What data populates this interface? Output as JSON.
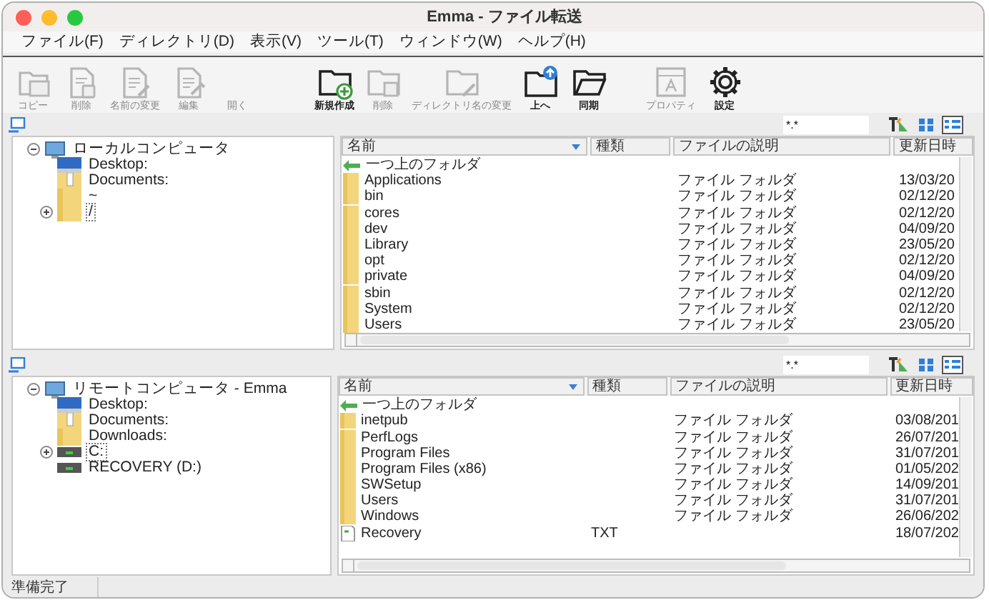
{
  "window": {
    "title": "Emma - ファイル転送"
  },
  "menu": [
    "ファイル(F)",
    "ディレクトリ(D)",
    "表示(V)",
    "ツール(T)",
    "ウィンドウ(W)",
    "ヘルプ(H)"
  ],
  "toolbar": [
    {
      "kind": "copy",
      "label": "コピー",
      "disabled": true
    },
    {
      "kind": "delete",
      "label": "削除",
      "disabled": true
    },
    {
      "kind": "rename",
      "label": "名前の変更",
      "disabled": true
    },
    {
      "kind": "edit",
      "label": "編集",
      "disabled": true
    },
    {
      "kind": "open",
      "label": "開く",
      "disabled": true
    },
    {
      "kind": "new-folder",
      "label": "新規作成",
      "disabled": false
    },
    {
      "kind": "delete-folder",
      "label": "削除",
      "disabled": true
    },
    {
      "kind": "rename-folder",
      "label": "ディレクトリ名の変更",
      "disabled": true
    },
    {
      "kind": "up",
      "label": "上へ",
      "disabled": false
    },
    {
      "kind": "sync",
      "label": "同期",
      "disabled": false
    },
    {
      "kind": "properties",
      "label": "プロパティ",
      "disabled": true
    },
    {
      "kind": "settings",
      "label": "設定",
      "disabled": false
    }
  ],
  "panes": [
    {
      "filter": "*.*",
      "view_buttons": [
        {
          "kind": "icons",
          "selected": false
        },
        {
          "kind": "details",
          "selected": true
        }
      ],
      "tree": [
        {
          "kind": "computer",
          "label": "ローカルコンピュータ",
          "expanded": true,
          "selected": false,
          "children": [
            {
              "kind": "desktop",
              "label": "Desktop:",
              "selected": false
            },
            {
              "kind": "documents",
              "label": "Documents:",
              "selected": false
            },
            {
              "kind": "folder",
              "label": "~",
              "selected": false
            },
            {
              "kind": "folder",
              "label": "/",
              "expanded": false,
              "selected": true
            }
          ]
        }
      ],
      "columns": [
        "名前",
        "種類",
        "ファイルの説明",
        "更新日時"
      ],
      "rows": [
        {
          "kind": "up",
          "name": "一つ上のフォルダ"
        },
        {
          "kind": "folder",
          "name": "Applications",
          "description": "ファイル フォルダ",
          "modified": "13/03/20"
        },
        {
          "kind": "folder",
          "name": "bin",
          "description": "ファイル フォルダ",
          "modified": "02/12/20"
        },
        {
          "kind": "folder",
          "name": "cores",
          "description": "ファイル フォルダ",
          "modified": "02/12/20"
        },
        {
          "kind": "folder",
          "name": "dev",
          "description": "ファイル フォルダ",
          "modified": "04/09/20"
        },
        {
          "kind": "folder",
          "name": "Library",
          "description": "ファイル フォルダ",
          "modified": "23/05/20"
        },
        {
          "kind": "folder",
          "name": "opt",
          "description": "ファイル フォルダ",
          "modified": "02/12/20"
        },
        {
          "kind": "folder",
          "name": "private",
          "description": "ファイル フォルダ",
          "modified": "04/09/20"
        },
        {
          "kind": "folder",
          "name": "sbin",
          "description": "ファイル フォルダ",
          "modified": "02/12/20"
        },
        {
          "kind": "folder",
          "name": "System",
          "description": "ファイル フォルダ",
          "modified": "02/12/20"
        },
        {
          "kind": "folder",
          "name": "Users",
          "description": "ファイル フォルダ",
          "modified": "23/05/20"
        }
      ]
    },
    {
      "filter": "*.*",
      "view_buttons": [
        {
          "kind": "icons",
          "selected": false
        },
        {
          "kind": "details",
          "selected": true
        }
      ],
      "tree": [
        {
          "kind": "computer",
          "label": "リモートコンピュータ - Emma",
          "expanded": true,
          "selected": false,
          "children": [
            {
              "kind": "desktop",
              "label": "Desktop:",
              "selected": false
            },
            {
              "kind": "documents",
              "label": "Documents:",
              "selected": false
            },
            {
              "kind": "folder",
              "label": "Downloads:",
              "selected": false
            },
            {
              "kind": "drive",
              "label": "C:",
              "expanded": false,
              "selected": true
            },
            {
              "kind": "drive",
              "label": "RECOVERY (D:)",
              "selected": false
            }
          ]
        }
      ],
      "columns": [
        "名前",
        "種類",
        "ファイルの説明",
        "更新日時"
      ],
      "rows": [
        {
          "kind": "up",
          "name": "一つ上のフォルダ"
        },
        {
          "kind": "folder",
          "name": "inetpub",
          "description": "ファイル フォルダ",
          "modified": "03/08/201"
        },
        {
          "kind": "folder",
          "name": "PerfLogs",
          "description": "ファイル フォルダ",
          "modified": "26/07/201"
        },
        {
          "kind": "folder",
          "name": "Program Files",
          "description": "ファイル フォルダ",
          "modified": "31/07/201"
        },
        {
          "kind": "folder",
          "name": "Program Files (x86)",
          "description": "ファイル フォルダ",
          "modified": "01/05/202"
        },
        {
          "kind": "folder",
          "name": "SWSetup",
          "description": "ファイル フォルダ",
          "modified": "14/09/201"
        },
        {
          "kind": "folder",
          "name": "Users",
          "description": "ファイル フォルダ",
          "modified": "31/07/201"
        },
        {
          "kind": "folder",
          "name": "Windows",
          "description": "ファイル フォルダ",
          "modified": "26/06/202"
        },
        {
          "kind": "file",
          "name": "Recovery",
          "type": "TXT",
          "modified": "18/07/202"
        }
      ]
    }
  ],
  "status_bar": "準備完了"
}
